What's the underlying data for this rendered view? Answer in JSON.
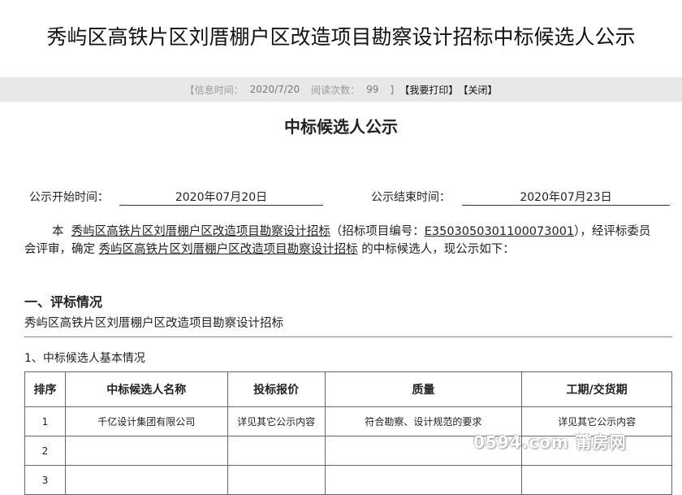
{
  "page_title": "秀屿区高铁片区刘厝棚户区改造项目勘察设计招标中标候选人公示",
  "info_bar": {
    "open_bracket": "【",
    "time_label": "信息时间：",
    "time_value": "2020/7/20",
    "read_label": "阅读次数：",
    "read_value": "99",
    "close_bracket": "】",
    "print_label": "【我要打印】",
    "close_label": "【关闭】"
  },
  "sub_title": "中标候选人公示",
  "dates": {
    "start_label": "公示开始时间：",
    "start_value": "2020年07月20日",
    "end_label": "公示结束时间：",
    "end_value": "2020年07月23日"
  },
  "intro": {
    "prefix": "本",
    "project1": "秀屿区高铁片区刘厝棚户区改造项目勘察设计招标",
    "mid1": "（招标项目编号：",
    "project_code": "E3503050301100073001",
    "mid2": "），经评标委员会评审，确定",
    "project2": "秀屿区高铁片区刘厝棚户区改造项目勘察设计招标",
    "suffix": "的中标候选人，现公示如下："
  },
  "section1": {
    "heading": "一、评标情况",
    "project_name": "秀屿区高铁片区刘厝棚户区改造项目勘察设计招标",
    "subheading": "1、中标候选人基本情况"
  },
  "table": {
    "headers": [
      "排序",
      "中标候选人名称",
      "投标报价",
      "质量",
      "工期/交货期"
    ],
    "rows": [
      [
        "1",
        "千亿设计集团有限公司",
        "详见其它公示内容",
        "符合勘察、设计规范的要求",
        "详见其它公示内容"
      ],
      [
        "2",
        "",
        "",
        "",
        ""
      ],
      [
        "3",
        "",
        "",
        "",
        ""
      ]
    ]
  },
  "watermark": "0594.com 莆房网"
}
